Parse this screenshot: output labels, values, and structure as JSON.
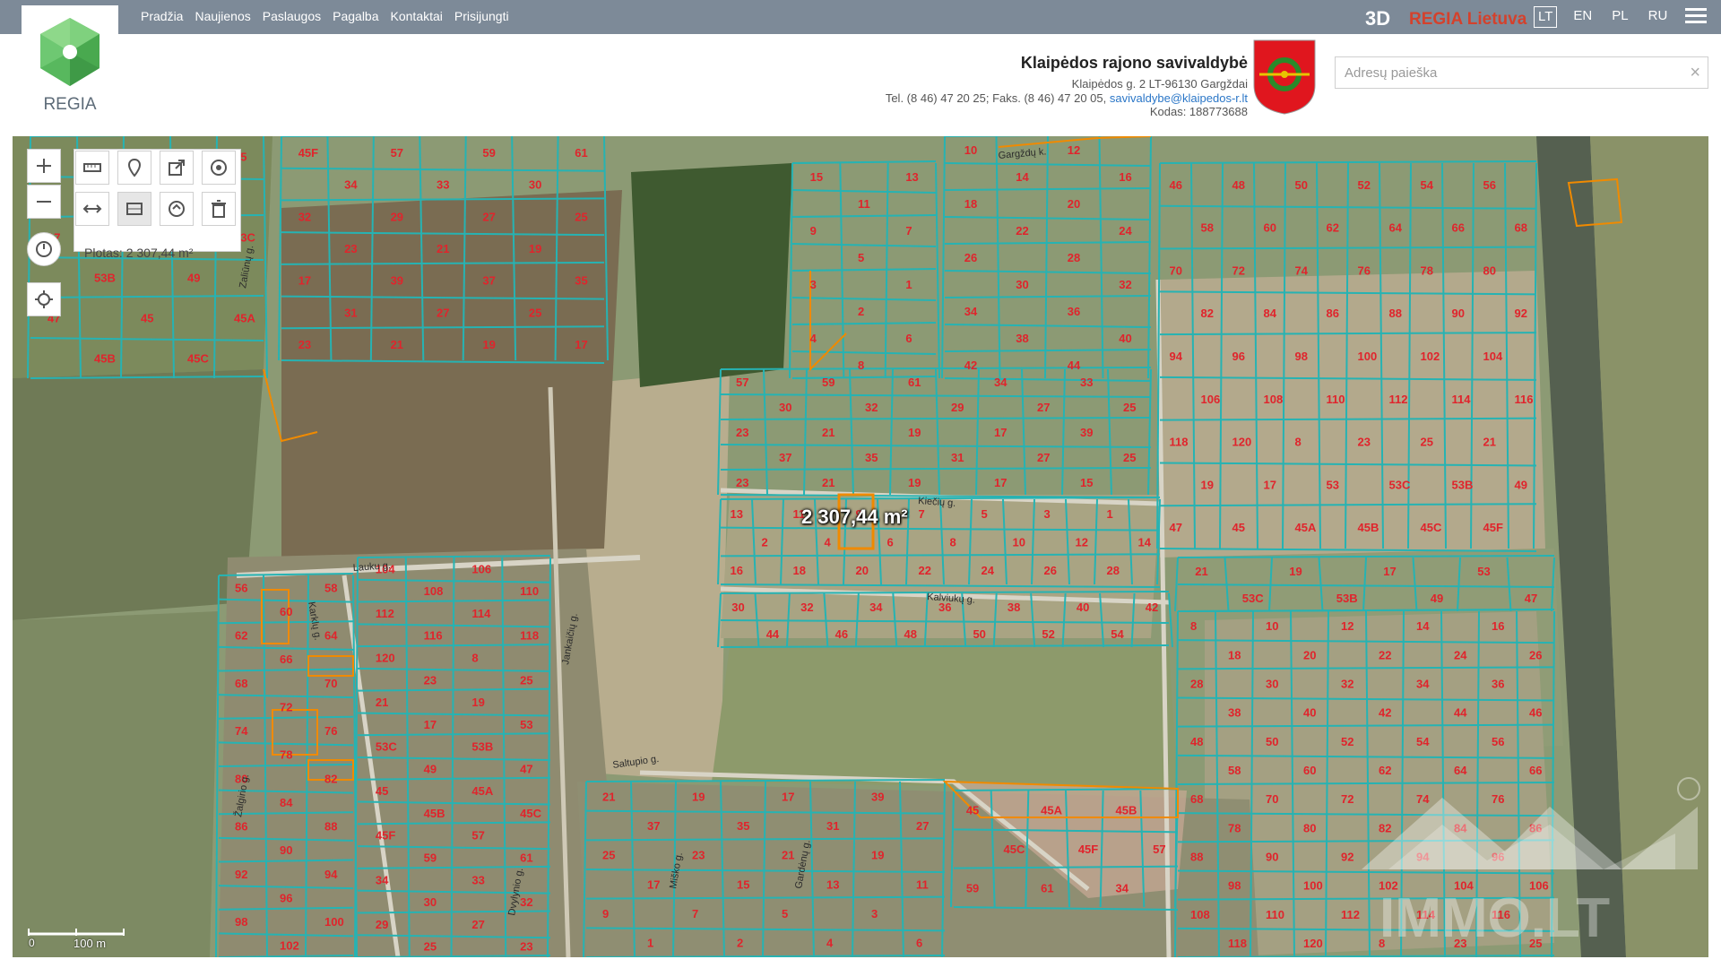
{
  "nav": {
    "items": [
      "Pradžia",
      "Naujienos",
      "Paslaugos",
      "Pagalba",
      "Kontaktai",
      "Prisijungti"
    ],
    "btn_3d": "3D",
    "regia_lietuva": "REGIA Lietuva",
    "languages": [
      "LT",
      "EN",
      "PL",
      "RU"
    ],
    "active_language": "LT"
  },
  "logo": {
    "text": "REGIA"
  },
  "municipality": {
    "name": "Klaipėdos rajono savivaldybė",
    "address": "Klaipėdos g. 2 LT-96130 Gargždai",
    "phones": "Tel. (8 46) 47 20 25; Faks. (8 46) 47 20 05,",
    "email": "savivaldybe@klaipedos-r.lt",
    "code": "Kodas: 188773688"
  },
  "search": {
    "placeholder": "Adresų paieška",
    "value": "",
    "clear_icon": "×"
  },
  "map": {
    "area_readout": "Plotas: 2 307,44 m²",
    "measure_label": "2 307,44 m²",
    "scale": "100 m",
    "scale_zero": "0",
    "watermark": "IMMO.LT",
    "streets": [
      "Lauku g.",
      "Karklų g.",
      "Kiečių g.",
      "Kalviukų g.",
      "Saltupio g.",
      "Dvylynio g.",
      "Miško g.",
      "Žalgirio g.",
      "Zaliūnų g.",
      "Gardėnų g.",
      "Jankaičių g.",
      "Gargždų k."
    ],
    "parcel_numbers": [
      "8",
      "23",
      "25",
      "21",
      "19",
      "17",
      "53",
      "53C",
      "53B",
      "49",
      "47",
      "45",
      "45A",
      "45B",
      "45C",
      "45F",
      "57",
      "59",
      "61",
      "34",
      "33",
      "30",
      "32",
      "29",
      "27",
      "25",
      "23",
      "21",
      "19",
      "17",
      "39",
      "37",
      "35",
      "31",
      "27",
      "25",
      "23",
      "21",
      "19",
      "17",
      "15",
      "13",
      "11",
      "9",
      "7",
      "5",
      "3",
      "1",
      "2",
      "4",
      "6",
      "8",
      "10",
      "12",
      "14",
      "16",
      "18",
      "20",
      "22",
      "24",
      "26",
      "28",
      "30",
      "32",
      "34",
      "36",
      "38",
      "40",
      "42",
      "44",
      "46",
      "48",
      "50",
      "52",
      "54",
      "56",
      "58",
      "60",
      "62",
      "64",
      "66",
      "68",
      "70",
      "72",
      "74",
      "76",
      "78",
      "80",
      "82",
      "84",
      "86",
      "88",
      "90",
      "92",
      "94",
      "96",
      "98",
      "100",
      "102",
      "104",
      "106",
      "108",
      "110",
      "112",
      "114",
      "116",
      "118",
      "120"
    ],
    "colors": {
      "parcel_line": "#26b3b3",
      "highlight": "#f08a00",
      "label": "#e0242c"
    }
  },
  "toolbar": {
    "zoom_in_icon": "plus-icon",
    "zoom_out_icon": "minus-icon",
    "tools": [
      "ruler-icon",
      "pin-icon",
      "export-icon",
      "target-icon",
      "measure-line-icon",
      "measure-area-icon",
      "route-icon",
      "trash-icon",
      "clock-icon",
      "locate-icon"
    ]
  }
}
